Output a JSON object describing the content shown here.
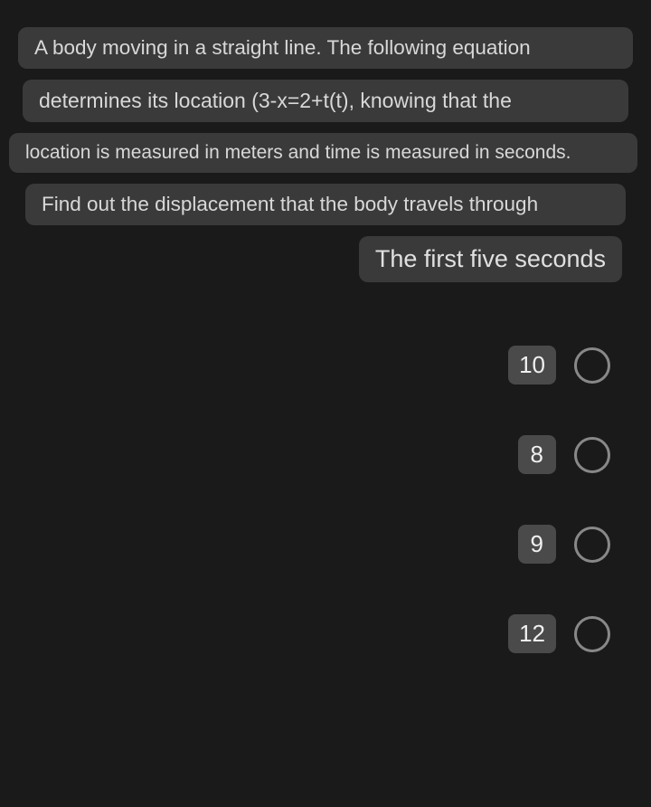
{
  "question": {
    "line1": "A body moving in a straight line. The following equation",
    "line2": "determines its location (3-x=2+t(t), knowing that the",
    "line3": "location is measured in meters and time is measured in seconds.",
    "line4": "Find out the displacement that the body travels through",
    "line5": "The first five seconds"
  },
  "options": [
    {
      "label": "10"
    },
    {
      "label": "8"
    },
    {
      "label": "9"
    },
    {
      "label": "12"
    }
  ]
}
